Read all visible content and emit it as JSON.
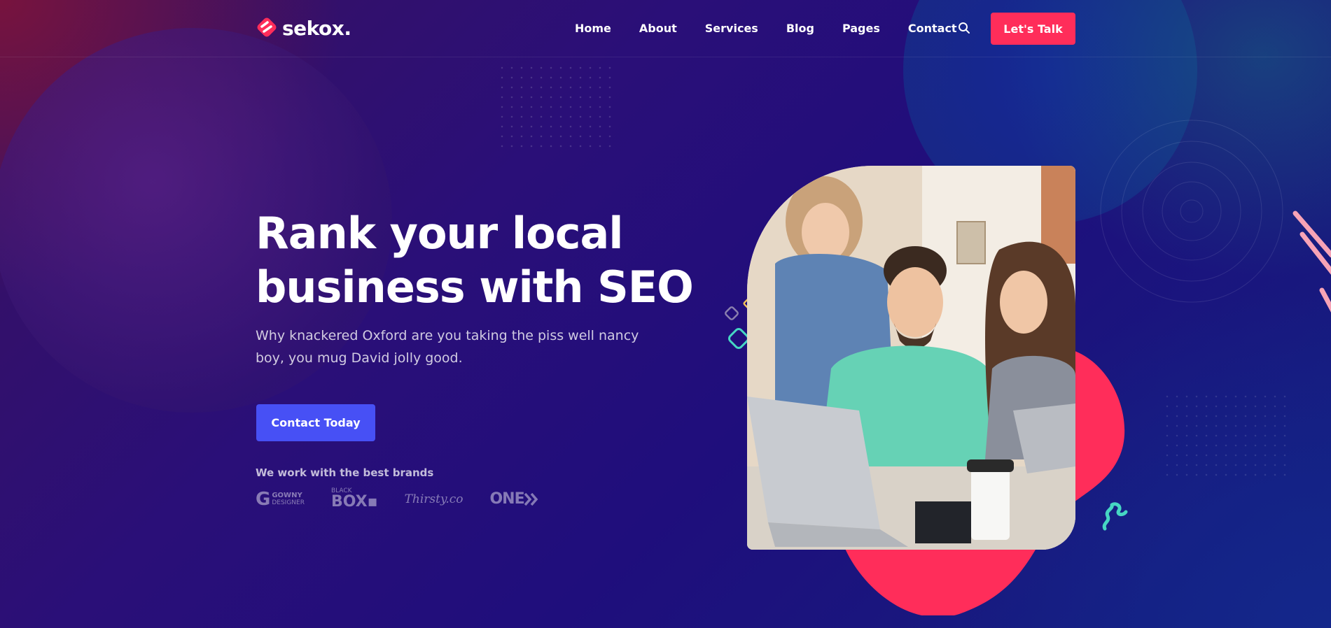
{
  "brand": {
    "name": "sekox."
  },
  "nav": {
    "items": [
      "Home",
      "About",
      "Services",
      "Blog",
      "Pages",
      "Contact"
    ],
    "cta_label": "Let's Talk"
  },
  "hero": {
    "title_line1": "Rank your local",
    "title_line2": "business with SEO",
    "subtitle_line1": "Why knackered Oxford are you taking the piss well nancy",
    "subtitle_line2": "boy, you mug David jolly good.",
    "button_label": "Contact Today"
  },
  "brands": {
    "heading": "We work with the best brands",
    "logos": {
      "gowny_g": "G",
      "gowny_top": "GOWNY",
      "gowny_bottom": "DESIGNER",
      "black_top": "BLACK",
      "black_bottom": "BOX",
      "thirsty": "Thirsty.co",
      "one": "ONE"
    }
  },
  "colors": {
    "accent_pink": "#ff2d5a",
    "accent_blue": "#4750f5",
    "accent_teal": "#46d6c3"
  },
  "icons": {
    "search": "search-icon",
    "logo": "logo-icon"
  }
}
